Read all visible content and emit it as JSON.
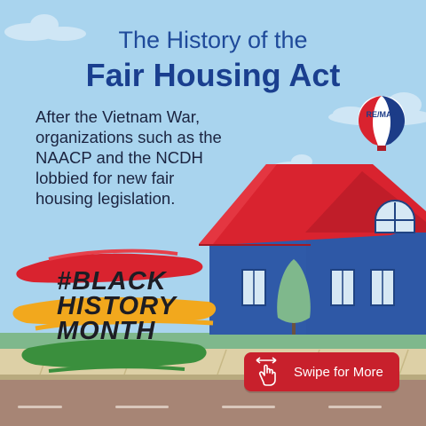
{
  "header": {
    "title_line1": "The History of the",
    "title_line2": "Fair Housing Act"
  },
  "body": {
    "lines": [
      "After the Vietnam War,",
      "organizations such as the",
      "NAACP and the NCDH",
      "lobbied for new fair",
      "housing legislation."
    ]
  },
  "badge": {
    "lines": [
      "#BLACK",
      "HISTORY",
      "MONTH"
    ]
  },
  "balloon": {
    "brand": "RE/MAX"
  },
  "cta": {
    "label": "Swipe for More"
  },
  "colors": {
    "sky": "#a9d4ee",
    "title": "#1a3f8f",
    "roof": "#d9232f",
    "house": "#2f5aa8",
    "cta": "#c8202c"
  }
}
